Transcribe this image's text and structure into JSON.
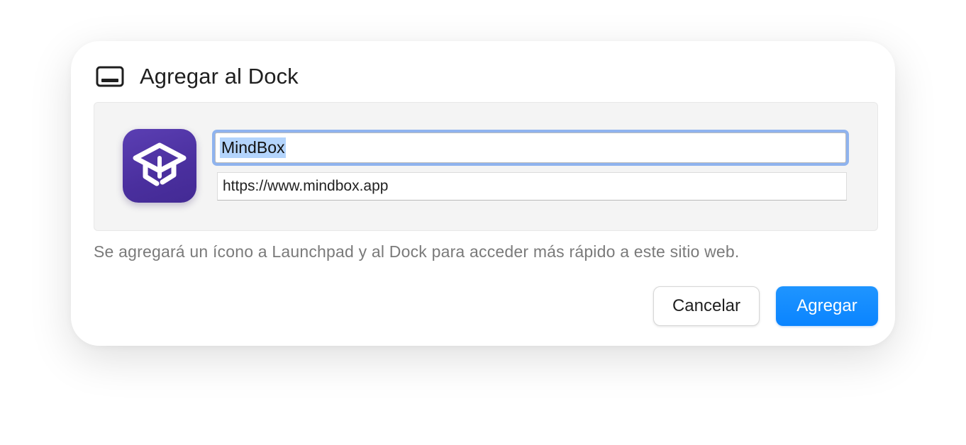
{
  "dialog": {
    "title": "Agregar al Dock",
    "title_icon": "dock-icon",
    "app_icon": "mindbox-app-icon",
    "name_field": {
      "value": "MindBox",
      "selected": true
    },
    "url_field": {
      "value": "https://www.mindbox.app"
    },
    "description": "Se agregará un ícono a Launchpad y al Dock para acceder más rápido a este sitio web.",
    "buttons": {
      "cancel_label": "Cancelar",
      "add_label": "Agregar"
    },
    "colors": {
      "accent": "#0a84ff",
      "app_icon_bg": "#4a2f9e",
      "focus_ring": "#8fb3ee",
      "selection": "#b3d4fc"
    }
  }
}
